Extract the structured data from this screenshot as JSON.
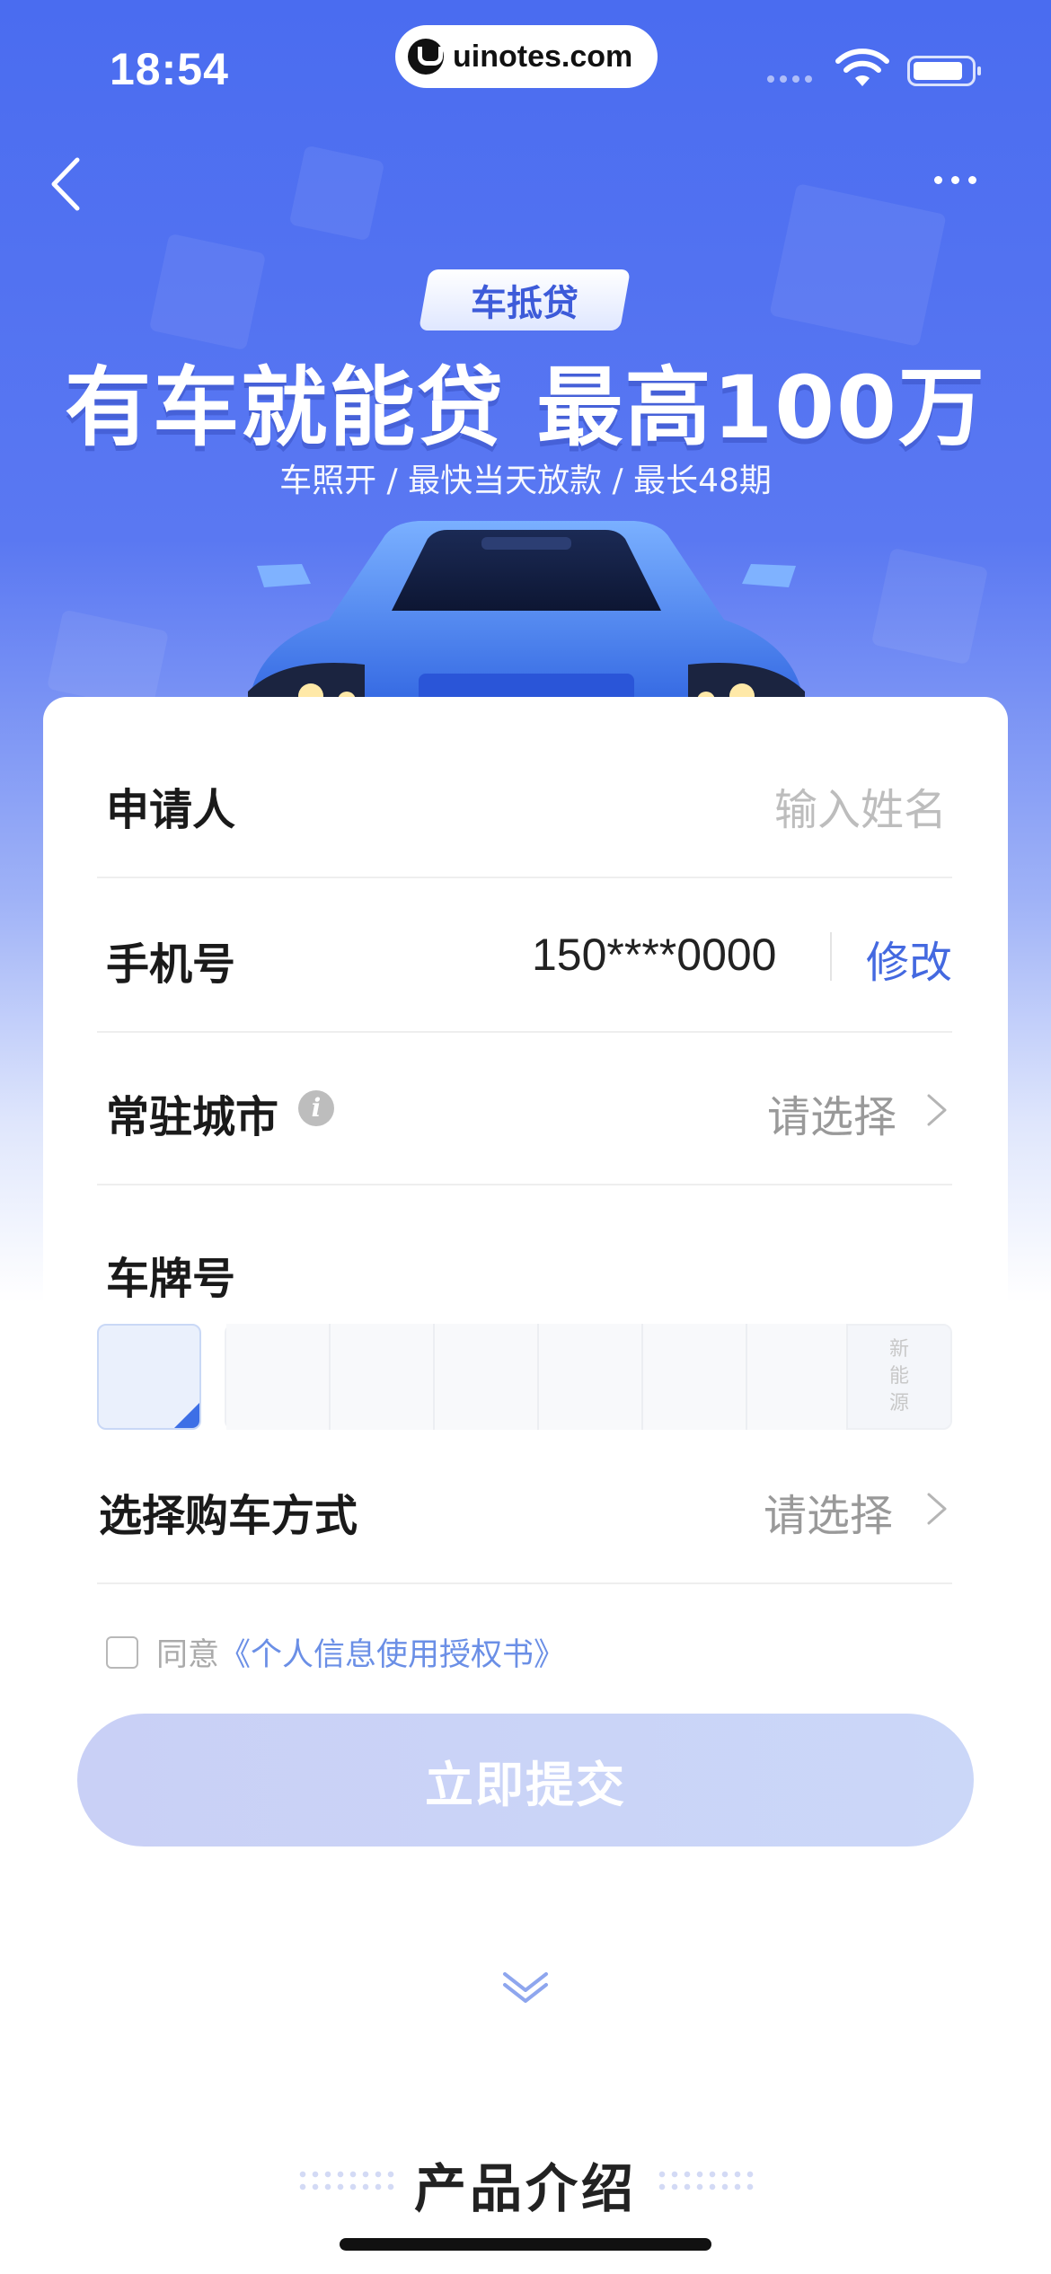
{
  "status_bar": {
    "time": "18:54",
    "url": "uinotes.com"
  },
  "nav": {
    "back_icon": "chevron-left-icon",
    "more_icon": "more-dots-icon"
  },
  "hero": {
    "badge": "车抵贷",
    "headline": "有车就能贷 最高100万",
    "subline": "车照开 / 最快当天放款 / 最长48期"
  },
  "form": {
    "applicant": {
      "label": "申请人",
      "placeholder": "输入姓名"
    },
    "phone": {
      "label": "手机号",
      "value": "150****0000",
      "action": "修改"
    },
    "city": {
      "label": "常驻城市",
      "info_icon": "i",
      "value": "请选择"
    },
    "plate": {
      "label": "车牌号",
      "new_energy": "新能源"
    },
    "purchase": {
      "label": "选择购车方式",
      "value": "请选择"
    },
    "agreement": {
      "prefix": "同意",
      "link": "《个人信息使用授权书》"
    },
    "submit": "立即提交"
  },
  "section": {
    "title": "产品介绍"
  },
  "colors": {
    "primary": "#4a6cf0",
    "link": "#4469e0",
    "submit_disabled": "#c9d0f6"
  }
}
